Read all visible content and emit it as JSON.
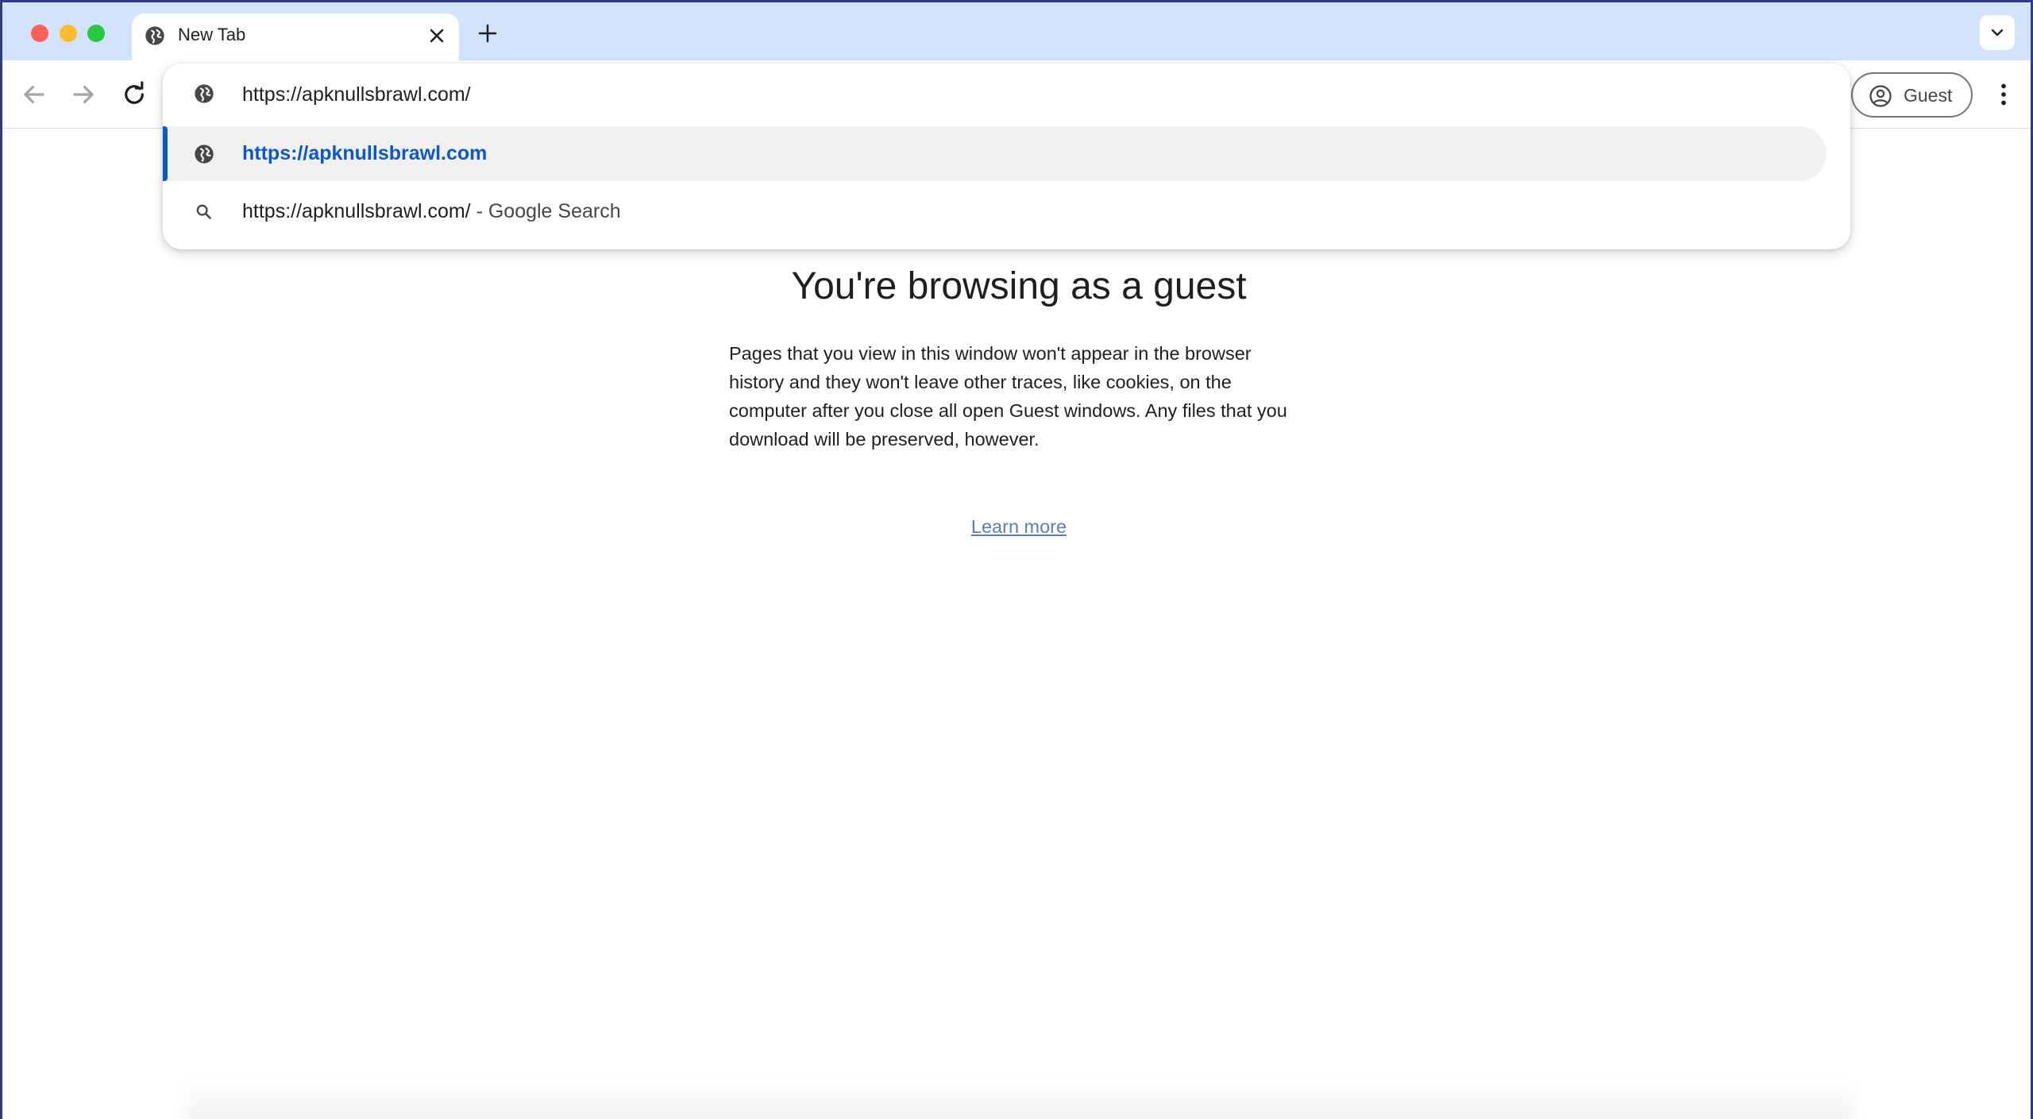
{
  "tab": {
    "title": "New Tab",
    "icon": "globe-icon"
  },
  "toolbar": {
    "profile_label": "Guest"
  },
  "omnibox": {
    "input_value": "https://apknullsbrawl.com/",
    "suggestions": [
      {
        "icon": "globe-icon",
        "text": "https://apknullsbrawl.com",
        "selected": true
      },
      {
        "icon": "search-icon",
        "text": "https://apknullsbrawl.com/",
        "suffix": "- Google Search"
      }
    ]
  },
  "page": {
    "title": "You're browsing as a guest",
    "body": "Pages that you view in this window won't appear in the browser history and they won't leave other traces, like cookies, on the computer after you close all open Guest windows. Any files that you download will be preserved, however.",
    "link": "Learn more"
  },
  "colors": {
    "tabstrip": "#d3e3fd",
    "accent": "#0b57d0",
    "link": "#5b7fb5"
  }
}
